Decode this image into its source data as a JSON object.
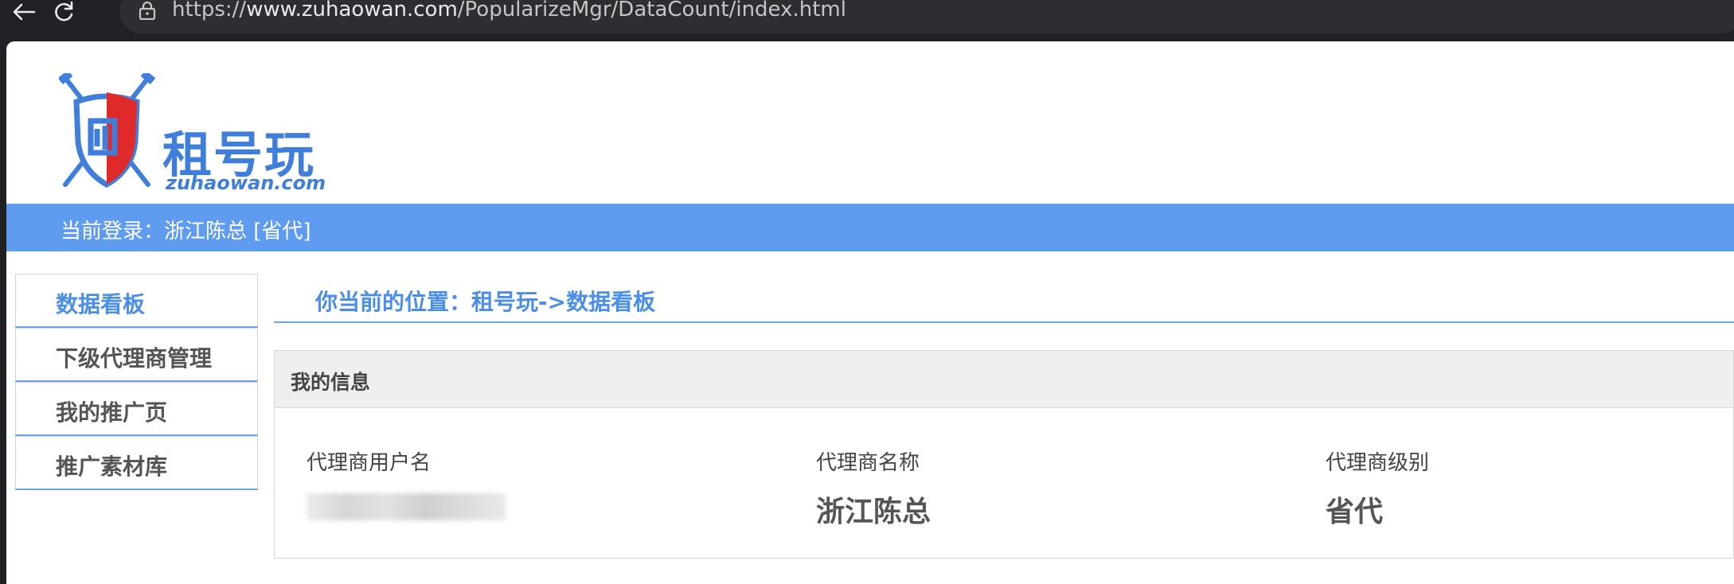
{
  "browser": {
    "url_prefix": "https://",
    "url_host": "www.zuhaowan.com",
    "url_path": "/PopularizeMgr/DataCount/index.html"
  },
  "logo": {
    "name": "租号玩",
    "domain": "zuhaowan.com"
  },
  "login_bar": {
    "text": "当前登录：浙江陈总 [省代]"
  },
  "sidebar": {
    "items": [
      {
        "label": "数据看板",
        "active": true
      },
      {
        "label": "下级代理商管理",
        "active": false
      },
      {
        "label": "我的推广页",
        "active": false
      },
      {
        "label": "推广素材库",
        "active": false
      }
    ]
  },
  "breadcrumb": {
    "text": "你当前的位置：租号玩->数据看板"
  },
  "panel": {
    "title": "我的信息",
    "fields": [
      {
        "label": "代理商用户名",
        "value": ""
      },
      {
        "label": "代理商名称",
        "value": "浙江陈总"
      },
      {
        "label": "代理商级别",
        "value": "省代"
      }
    ]
  },
  "colors": {
    "accent": "#5f9cf0",
    "link": "#4a8ee8",
    "shield_red": "#e02a2a"
  }
}
